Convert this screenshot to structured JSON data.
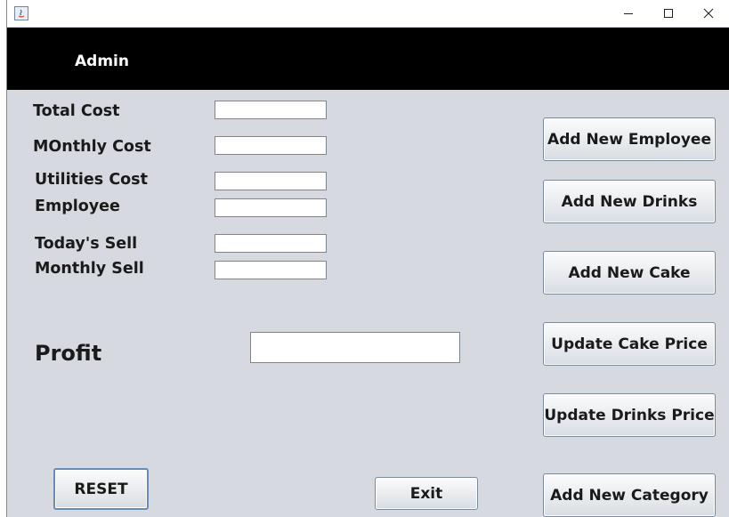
{
  "window": {
    "title": "",
    "controls": [
      "minimize-icon",
      "maximize-icon",
      "close-icon"
    ]
  },
  "header": {
    "title": "Admin"
  },
  "form": {
    "total_cost": {
      "label": "Total Cost",
      "value": ""
    },
    "monthly_cost": {
      "label": "MOnthly Cost",
      "value": ""
    },
    "utilities_cost": {
      "label": "Utilities Cost",
      "value": ""
    },
    "employee": {
      "label": "Employee",
      "value": ""
    },
    "todays_sell": {
      "label": "Today's Sell",
      "value": ""
    },
    "monthly_sell": {
      "label": "Monthly Sell",
      "value": ""
    },
    "profit": {
      "label": "Profit",
      "value": ""
    }
  },
  "actions": {
    "add_employee": "Add New Employee",
    "add_drinks": "Add New Drinks",
    "add_cake": "Add New Cake",
    "update_cake_price": "Update Cake Price",
    "update_drinks_price": "Update Drinks Price",
    "add_category": "Add New Category",
    "reset": "RESET",
    "exit": "Exit"
  }
}
